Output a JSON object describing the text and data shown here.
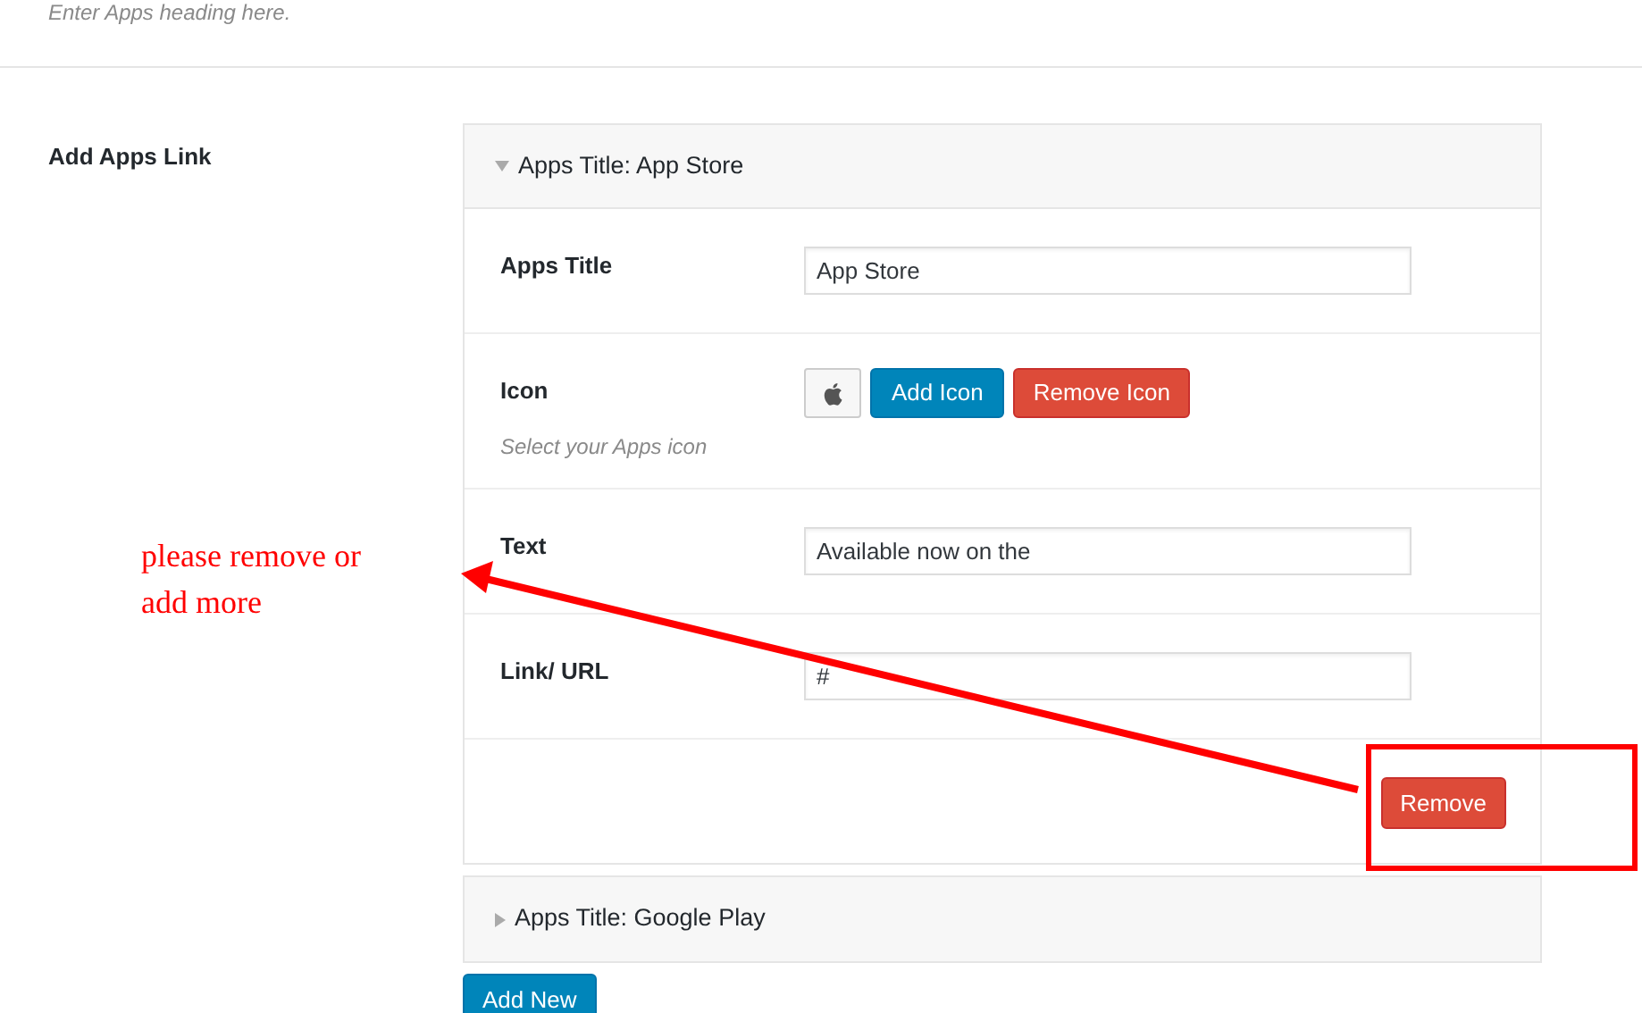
{
  "heading_hint": "Enter Apps heading here.",
  "section": {
    "label": "Add Apps Link",
    "groups": [
      {
        "title": "Apps Title: App Store",
        "expanded": true,
        "fields": [
          {
            "kind": "text",
            "label": "Apps Title",
            "value": "App Store"
          },
          {
            "kind": "icon",
            "label": "Icon",
            "description": "Select your Apps icon",
            "buttons": [
              "Add Icon",
              "Remove Icon"
            ]
          },
          {
            "kind": "text",
            "label": "Text",
            "value": "Available now on the"
          },
          {
            "kind": "text",
            "label": "Link/ URL",
            "value": "#"
          }
        ],
        "remove_button": "Remove"
      },
      {
        "title": "Apps Title: Google Play",
        "expanded": false
      }
    ],
    "add_button": "Add New"
  },
  "annotation": {
    "text": "please remove or add more"
  }
}
